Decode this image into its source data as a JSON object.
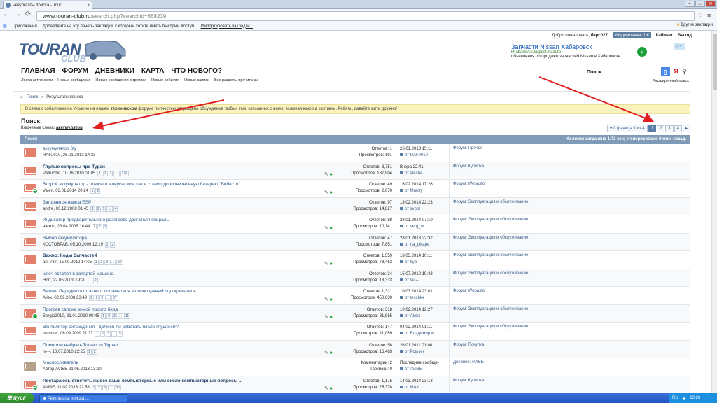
{
  "browser": {
    "tab_title": "Результаты поиска - Tour...",
    "url_host": "www.touran-club.ru",
    "url_path": "/search.php?searchid=868239",
    "bookmarks_label": "Приложения",
    "bookmarks_hint": "Добавляйте на эту панель закладки, к которым хотите иметь быстрый доступ.",
    "bookmarks_import": "Импортировать закладки...",
    "bookmarks_other": "Другие закладки"
  },
  "userbar": {
    "welcome": "Добро пожаловать,",
    "username": "барс027",
    "notifications": "Уведомления: 1 ▾",
    "cabinet": "Кабинет",
    "logout": "Выход"
  },
  "logo": {
    "line1": "TOURAN",
    "line2": "CLUB"
  },
  "ad": {
    "title": "Запчасти Nissan Хабаровск",
    "site": "khabarovsk.farpost.ru/auto",
    "desc": "объявления по продаже запчастей Nissan в Хабаровске"
  },
  "mainnav": [
    "ГЛАВНАЯ",
    "ФОРУМ",
    "ДНЕВНИКИ",
    "КАРТА",
    "ЧТО НОВОГО?"
  ],
  "subnav": [
    "Лента активности",
    "Новые сообщения",
    "Новые сообщения в группах",
    "Новые события",
    "Новые записи",
    "Все разделы прочитаны"
  ],
  "search": {
    "label": "Поиск",
    "advanced": "Расширенный поиск"
  },
  "breadcrumb": {
    "home": "Поиск",
    "current": "Результаты поиска"
  },
  "notice": {
    "before": "В связи с событиями на Украине на нашем ",
    "bold": "техническом",
    "after": " форуме полностью запрещено обсуждение любых тем, связанных с ними, включая юмор и картинки. Ребята, давайте жить дружно!"
  },
  "results": {
    "title": "Поиск:",
    "keywords_label": "Ключевые слова:",
    "keyword": "аккумулятор",
    "header_left": "Поиск",
    "header_right": "На поиск затрачено 1.73 сек; сгенерировано 6 мин. назад."
  },
  "pager": {
    "label": "▾ Страница 1 из 4",
    "pages": [
      "1",
      "2",
      "3",
      "4"
    ],
    "next": "▸"
  },
  "rows": [
    {
      "title": "аккумулятор 6ty",
      "bold": false,
      "meta": "RAF2010, 26.01.2013 14:33",
      "pages": "",
      "s1": "Ответов: 1",
      "s2": "Просмотров: 191",
      "l1": "26.01.2013 15:11",
      "l2": "от RAF2010",
      "forum": "Форум: Прочее",
      "icon": "plain",
      "attach": false
    },
    {
      "title": "Глупые вопросы про Туран",
      "bold": true,
      "meta": "Petrucdio, 10.06.2010 01:05",
      "pages": "1 2 3 ... 126",
      "s1": "Ответов: 3,751",
      "s2": "Просмотров: 187,904",
      "l1": "Вчера 22:41",
      "l2": "от alex64",
      "forum": "Форум: Курилка",
      "icon": "plain",
      "attach": true
    },
    {
      "title": "Второй аккумулятор - плюсы и минусы, или как я ставил дополнительную батарею \"Вебасто\"",
      "bold": false,
      "meta": "Valeri, 03.01.2014 20:24",
      "pages": "1 2",
      "s1": "Ответов: 49",
      "s2": "Просмотров: 2,070",
      "l1": "16.02.2014 17:26",
      "l2": "от Mracty",
      "forum": "Форум: Webasto",
      "icon": "new",
      "attach": true
    },
    {
      "title": "Загорается лампа ESP",
      "bold": false,
      "meta": "andre, 03.12.2008 01:45",
      "pages": "1 2 3 ... 4",
      "s1": "Ответов: 97",
      "s2": "Просмотров: 14,827",
      "l1": "18.02.2014 22:23",
      "l2": "от svopt",
      "forum": "Форум: Эксплуатация и обслуживание",
      "icon": "plain",
      "attach": false
    },
    {
      "title": "Индикатор предварительного разогрева двигателя спираль",
      "bold": false,
      "meta": "alexnc, 23.04.2008 16:44",
      "pages": "1 2 3",
      "s1": "Ответов: 88",
      "s2": "Просмотров: 10,141",
      "l1": "23.01.2014 07:10",
      "l2": "от serg_w",
      "forum": "Форум: Эксплуатация и обслуживание",
      "icon": "plain",
      "attach": true
    },
    {
      "title": "Выбор аккумулятора.",
      "bold": false,
      "meta": "КОСТОВРАВ, 05.10.2009 12:19",
      "pages": "1 2",
      "s1": "Ответов: 47",
      "s2": "Просмотров: 7,851",
      "l1": "28.01.2013 22:32",
      "l2": "от na_pikape",
      "forum": "Форум: Эксплуатация и обслуживание",
      "icon": "plain",
      "attach": false
    },
    {
      "title": "Важно: Коды Запчастей",
      "bold": true,
      "meta": "ant 787, 15.09.2012 14:05",
      "pages": "1 2 3 ... 52",
      "s1": "Ответов: 1,559",
      "s2": "Просмотров: 78,462",
      "l1": "18.03.2014 10:11",
      "l2": "от Ilya",
      "forum": "Форум: Эксплуатация и обслуживание",
      "icon": "plain",
      "attach": true
    },
    {
      "title": "ключ остался в запертой машине.",
      "bold": false,
      "meta": "Horr, 22.05.2009 19:20",
      "pages": "1 2",
      "s1": "Ответов: 34",
      "s2": "Просмотров: 13,333",
      "l1": "15.07.2010 19:43",
      "l2": "от sv---",
      "forum": "Форум: Эксплуатация и обслуживание",
      "icon": "plain",
      "attach": false
    },
    {
      "title": "Важно: Переделка штатного догревателя в полноценный подогреватель",
      "bold": false,
      "meta": "Allex, 02.09.2008 23:49",
      "pages": "1 2 3 ... 67",
      "s1": "Ответов: 1,321",
      "s2": "Просмотров: 450,630",
      "l1": "10.03.2014 23:01",
      "l2": "от teschke",
      "forum": "Форум: Webasto",
      "icon": "plain",
      "attach": true
    },
    {
      "title": "Прогрев салона зимой просто беда",
      "bold": false,
      "meta": "Sergio2010, 31.01.2010 00:45",
      "pages": "1 2 3 ... 11",
      "s1": "Ответов: 318",
      "s2": "Просмотров: 31,965",
      "l1": "10.02.2014 12:27",
      "l2": "от Alekz",
      "forum": "Форум: Эксплуатация и обслуживание",
      "icon": "new",
      "attach": true
    },
    {
      "title": "Вентилятор охлаждения - должен ли работать после глушения?",
      "bold": false,
      "meta": "bemmer, 06.09.2009 21:37",
      "pages": "1 2 3 ... 5",
      "s1": "Ответов: 147",
      "s2": "Просмотров: 11,059",
      "l1": "04.02.2014 01:11",
      "l2": "от Владимир w",
      "forum": "Форум: Эксплуатация и обслуживание",
      "icon": "plain",
      "attach": false
    },
    {
      "title": "Помогите выбрать Touran vs Tiguan",
      "bold": false,
      "meta": "iv---, 10.07.2010 22:25",
      "pages": "1 2",
      "s1": "Ответов: 58",
      "s2": "Просмотров: 16,483",
      "l1": "26.01.2011 01:08",
      "l2": "от Ром и к",
      "forum": "Форум: Покупка",
      "icon": "plain",
      "attach": true
    },
    {
      "title": "Маслосливатель",
      "bold": false,
      "meta": "Автор AVIBE 21.05.2013 13:20",
      "pages": "",
      "s1": "Комментарии: 2",
      "s2": "Трекбэки: 0",
      "l1": "Последнее сообще-",
      "l2": "от AVIBE",
      "forum": "Дневник: AVIBE",
      "icon": "diary",
      "attach": false
    },
    {
      "title": "Постараюсь ответить на все ваши компьютерные или около компьютерные вопросы ...",
      "bold": true,
      "meta": "AVIBE, 11.02.2013 22:58",
      "pages": "1 2 3 ... 30",
      "s1": "Ответов: 1,175",
      "s2": "Просмотров: 25,378",
      "l1": "14.03.2014 23:18",
      "l2": "от MAK",
      "forum": "Форум: Курилка",
      "icon": "new",
      "attach": true
    }
  ],
  "taskbar": {
    "start": "пуск",
    "item": "Результаты поиска ...",
    "lang": "RU",
    "clock": "13:26"
  }
}
